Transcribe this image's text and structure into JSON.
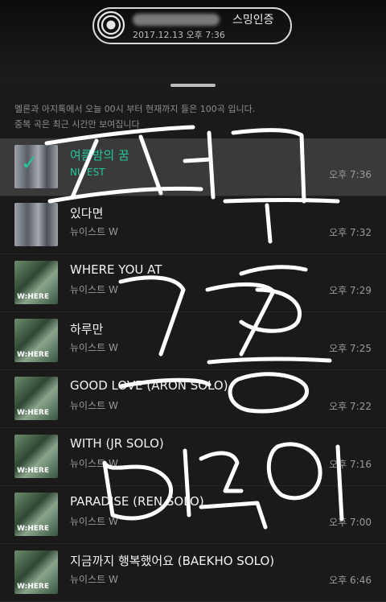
{
  "widget": {
    "title": "스밍인증",
    "datetime": "2017.12.13 오후 7:36",
    "icon": "disc-icon"
  },
  "notice": {
    "line1": "멜론과 아지톡에서 오늘 00시 부터 현재까지 들은 100곡 입니다.",
    "line2": "중복 곡은 최근 시간만 보여집니다"
  },
  "tracks": [
    {
      "title": "여름밤의 꿈",
      "artist": "NU'EST",
      "time": "오후 7:36",
      "selected": true
    },
    {
      "title": "있다면",
      "artist": "뉴이스트 W",
      "time": "오후 7:32"
    },
    {
      "title": "WHERE YOU AT",
      "artist": "뉴이스트 W",
      "time": "오후 7:29"
    },
    {
      "title": "하루만",
      "artist": "뉴이스트 W",
      "time": "오후 7:25"
    },
    {
      "title": "GOOD LOVE (ARON SOLO)",
      "artist": "뉴이스트 W",
      "time": "오후 7:22"
    },
    {
      "title": "WITH (JR SOLO)",
      "artist": "뉴이스트 W",
      "time": "오후 7:16"
    },
    {
      "title": "PARADISE (REN SOLO)",
      "artist": "뉴이스트 W",
      "time": "오후 7:00"
    },
    {
      "title": "지금까지 행복했어요 (BAEKHO SOLO)",
      "artist": "뉴이스트 W",
      "time": "오후 6:46"
    }
  ],
  "album_text": "W:HERE",
  "colors": {
    "accent": "#21c79a",
    "background": "#1a1a1a"
  }
}
